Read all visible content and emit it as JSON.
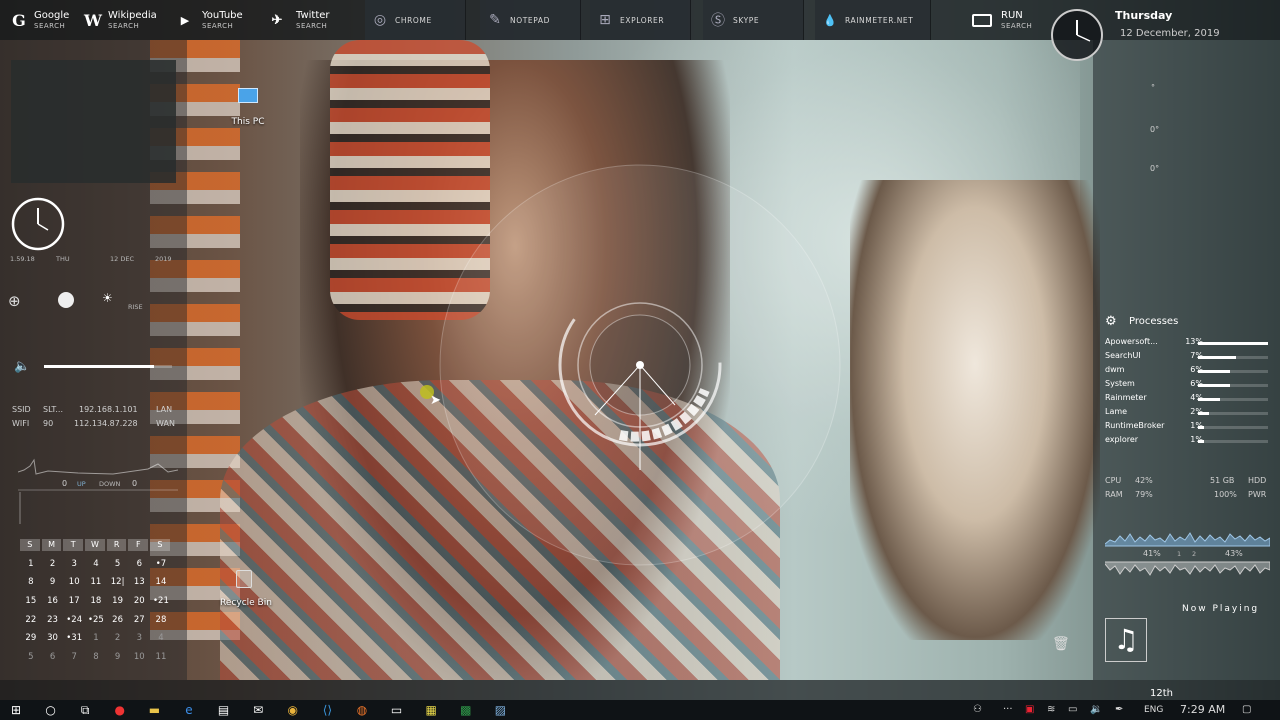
{
  "topbar": {
    "launchers": [
      {
        "icon": "google-icon",
        "glyph": "G",
        "name": "Google",
        "sub": "SEARCH"
      },
      {
        "icon": "wikipedia-icon",
        "glyph": "W",
        "name": "Wikipedia",
        "sub": "SEARCH"
      },
      {
        "icon": "youtube-icon",
        "glyph": "▶",
        "name": "YouTube",
        "sub": "SEARCH"
      },
      {
        "icon": "twitter-icon",
        "glyph": "✈",
        "name": "Twitter",
        "sub": "SEARCH"
      }
    ],
    "apps": [
      {
        "icon": "chrome-icon",
        "glyph": "◎",
        "label": "CHROME"
      },
      {
        "icon": "notepad-icon",
        "glyph": "✎",
        "label": "NOTEPAD"
      },
      {
        "icon": "explorer-icon",
        "glyph": "⊞",
        "label": "EXPLORER"
      },
      {
        "icon": "skype-icon",
        "glyph": "Ⓢ",
        "label": "SKYPE"
      },
      {
        "icon": "rainmeter-icon",
        "glyph": "💧",
        "label": "RAINMETER.NET"
      }
    ],
    "run": {
      "label": "RUN",
      "sub": "SEARCH"
    },
    "day": "Thursday",
    "date": "12 December, 2019"
  },
  "desktop_icons": [
    {
      "icon": "this-pc-icon",
      "label": "This PC"
    },
    {
      "icon": "recycle-bin-icon",
      "label": "Recycle Bin"
    }
  ],
  "left": {
    "time_small": "1.59.18",
    "day_small": "THU",
    "date_small": "12 DEC",
    "year_small": "2019",
    "rise_label": "RISE",
    "network": {
      "ssid_label": "SSID",
      "ssid": "SLT...",
      "ip1": "192.168.1.101",
      "lan": "LAN",
      "wifi_label": "WIFI",
      "wifi": "90",
      "ip2": "112.134.87.228",
      "wan": "WAN"
    },
    "traffic": {
      "up_val": "0",
      "up": "UP",
      "down": "DOWN",
      "down_val": "0"
    },
    "calendar": {
      "headers": [
        "S",
        "M",
        "T",
        "W",
        "R",
        "F",
        "S"
      ],
      "rows": [
        [
          "1",
          "2",
          "3",
          "4",
          "5",
          "6",
          "•7"
        ],
        [
          "8",
          "9",
          "10",
          "11",
          "12|",
          "13",
          "14"
        ],
        [
          "15",
          "16",
          "17",
          "18",
          "19",
          "20",
          "•21"
        ],
        [
          "22",
          "23",
          "•24",
          "•25",
          "26",
          "27",
          "28"
        ],
        [
          "29",
          "30",
          "•31",
          "1",
          "2",
          "3",
          "4"
        ],
        [
          "5",
          "6",
          "7",
          "8",
          "9",
          "10",
          "11"
        ]
      ]
    }
  },
  "right": {
    "weather": [
      "°",
      "0°",
      "0°"
    ],
    "processes_title": "Processes",
    "processes": [
      {
        "name": "Apowersoft...",
        "pct": "13%",
        "frac": 1.0
      },
      {
        "name": "SearchUI",
        "pct": "7%",
        "frac": 0.54
      },
      {
        "name": "dwm",
        "pct": "6%",
        "frac": 0.46
      },
      {
        "name": "System",
        "pct": "6%",
        "frac": 0.46
      },
      {
        "name": "Rainmeter",
        "pct": "4%",
        "frac": 0.31
      },
      {
        "name": "Lame",
        "pct": "2%",
        "frac": 0.15
      },
      {
        "name": "RuntimeBroker",
        "pct": "1%",
        "frac": 0.08
      },
      {
        "name": "explorer",
        "pct": "1%",
        "frac": 0.08
      }
    ],
    "cpu_label": "CPU",
    "cpu": "42%",
    "hdd_val": "51 GB",
    "hdd": "HDD",
    "ram_label": "RAM",
    "ram": "79%",
    "pwr_val": "100%",
    "pwr": "PWR",
    "core1": "41%",
    "core_1": "1",
    "core_2": "2",
    "core2": "43%",
    "now_playing": "Now Playing"
  },
  "dock": {
    "date_text": "12th"
  },
  "taskbar": {
    "apps": [
      "windows-icon",
      "search-icon",
      "task-view-icon",
      "opera-icon",
      "file-explorer-icon",
      "edge-icon",
      "store-icon",
      "mail-icon",
      "chrome-icon",
      "vscode-icon",
      "firefox-icon",
      "terminal-icon",
      "sticky-notes-icon",
      "excel-icon",
      "photos-icon"
    ],
    "lang": "ENG",
    "time": "7:29 AM"
  }
}
